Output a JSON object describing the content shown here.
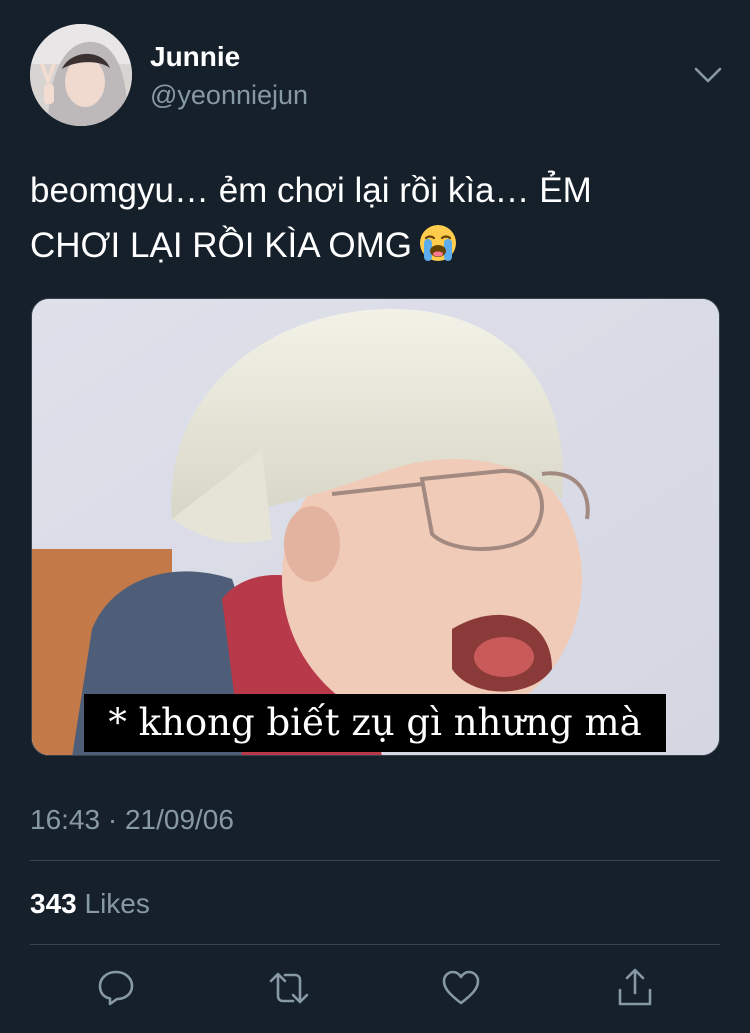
{
  "tweet": {
    "display_name": "Junnie",
    "handle": "@yeonniejun",
    "text_line1": "beomgyu… ẻm chơi lại rồi kìa… ẺM",
    "text_line2": "CHƠI LẠI RỒI KÌA OMG",
    "emoji": "loudly-crying-face",
    "media_caption": "* khong biết zụ gì nhưng mà",
    "timestamp": "16:43 · 21/09/06",
    "likes_count": "343",
    "likes_label": "Likes"
  },
  "actions": {
    "reply_icon": "reply-icon",
    "retweet_icon": "retweet-icon",
    "like_icon": "heart-icon",
    "share_icon": "share-icon"
  },
  "colors": {
    "background": "#15202b",
    "primary_text": "#ffffff",
    "secondary_text": "#8899a6",
    "divider": "#38444d"
  }
}
